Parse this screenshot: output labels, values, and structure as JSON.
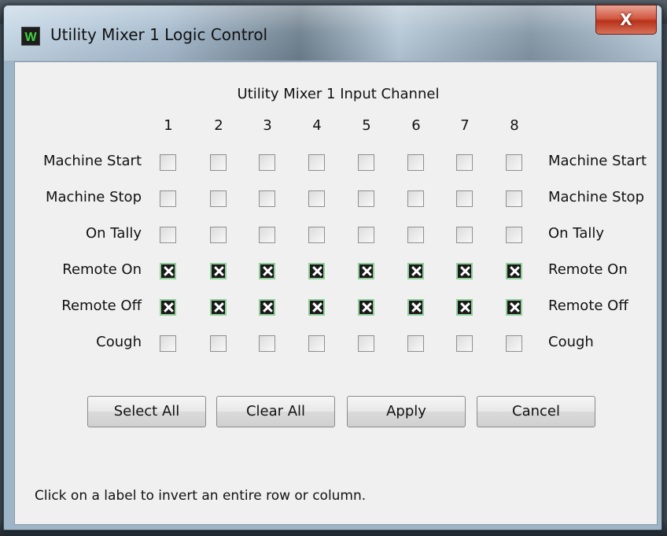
{
  "window": {
    "title": "Utility Mixer 1 Logic Control",
    "close_glyph": "X",
    "icon": "w-app-icon",
    "icon_text": "W"
  },
  "grid": {
    "title": "Utility Mixer 1 Input Channel",
    "columns": [
      "1",
      "2",
      "3",
      "4",
      "5",
      "6",
      "7",
      "8"
    ],
    "rows": [
      {
        "label": "Machine Start",
        "checked": [
          false,
          false,
          false,
          false,
          false,
          false,
          false,
          false
        ]
      },
      {
        "label": "Machine Stop",
        "checked": [
          false,
          false,
          false,
          false,
          false,
          false,
          false,
          false
        ]
      },
      {
        "label": "On Tally",
        "checked": [
          false,
          false,
          false,
          false,
          false,
          false,
          false,
          false
        ]
      },
      {
        "label": "Remote On",
        "checked": [
          true,
          true,
          true,
          true,
          true,
          true,
          true,
          true
        ]
      },
      {
        "label": "Remote Off",
        "checked": [
          true,
          true,
          true,
          true,
          true,
          true,
          true,
          true
        ]
      },
      {
        "label": "Cough",
        "checked": [
          false,
          false,
          false,
          false,
          false,
          false,
          false,
          false
        ]
      }
    ]
  },
  "buttons": {
    "select_all": "Select All",
    "clear_all": "Clear All",
    "apply": "Apply",
    "cancel": "Cancel"
  },
  "hint": "Click on a label to invert an entire row or column.",
  "colors": {
    "checked_fill": "#1a1a1a",
    "checked_border": "#8fcf9a",
    "close_red": "#d25a43"
  }
}
